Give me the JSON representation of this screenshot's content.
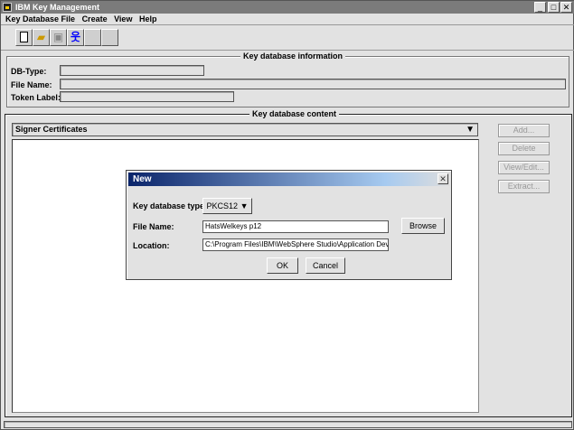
{
  "window": {
    "title": "IBM Key Management"
  },
  "menu": [
    "Key Database File",
    "Create",
    "View",
    "Help"
  ],
  "toolbar": {
    "icons": [
      "new-file-icon",
      "open-folder-icon",
      "save-disk-icon",
      "user-icon",
      "blank-icon",
      "blank-icon"
    ]
  },
  "info": {
    "title": "Key database information",
    "db_type_label": "DB-Type:",
    "file_name_label": "File Name:",
    "token_label": "Token Label:"
  },
  "content": {
    "title": "Key database content",
    "dropdown": "Signer Certificates",
    "buttons": [
      "Add...",
      "Delete",
      "View/Edit...",
      "Extract..."
    ]
  },
  "dialog": {
    "title": "New",
    "type_label": "Key database type",
    "type_value": "PKCS12",
    "file_label": "File Name:",
    "file_value": "HatsWelkeys p12",
    "browse": "Browse",
    "location_label": "Location:",
    "location_value": "C:\\Program Files\\IBM\\WebSphere Studio\\Application Develo",
    "ok": "OK",
    "cancel": "Cancel"
  }
}
